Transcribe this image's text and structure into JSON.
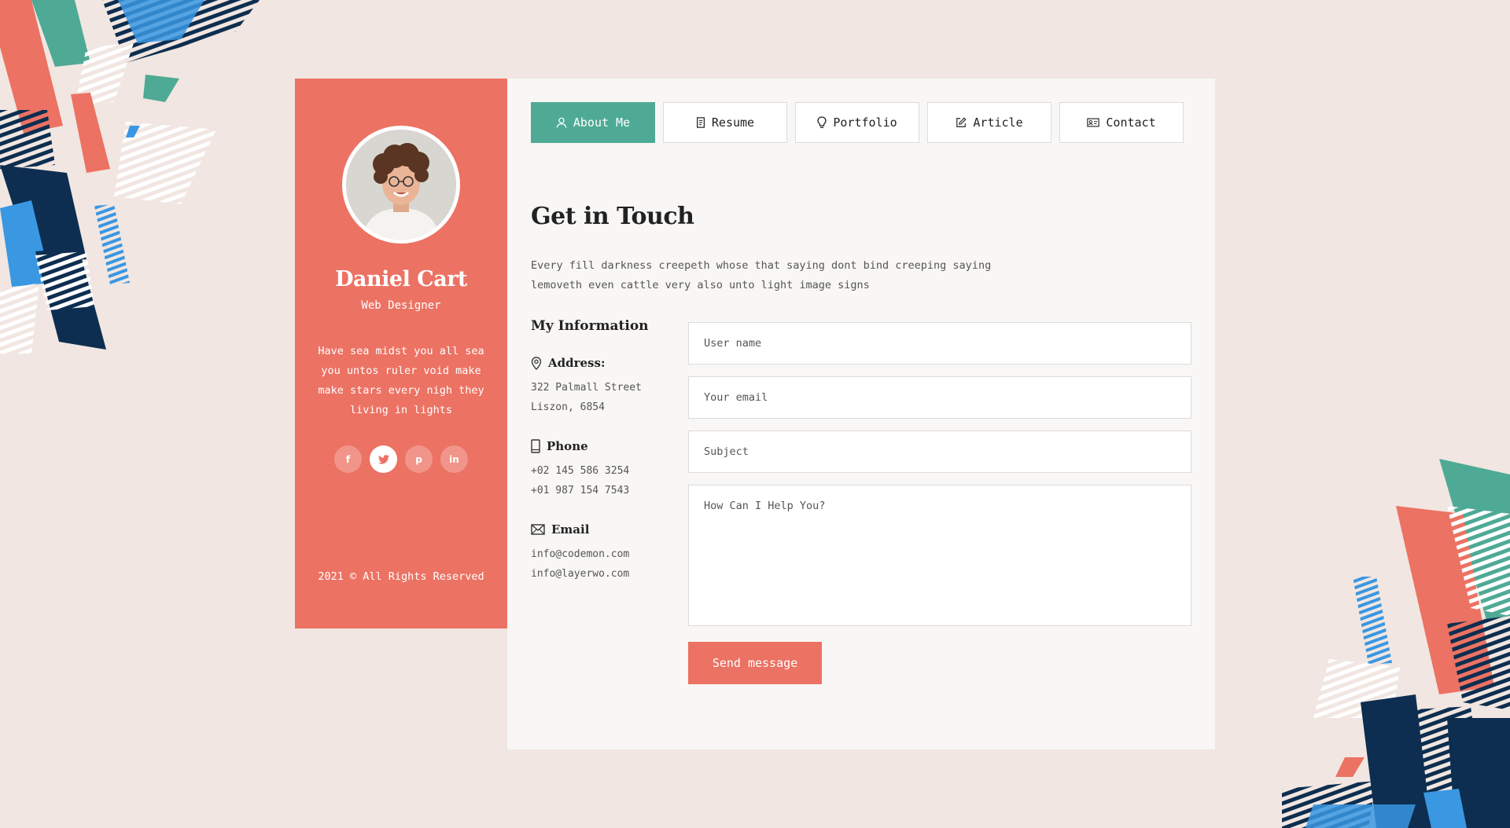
{
  "profile": {
    "name": "Daniel Cart",
    "role": "Web Designer",
    "bio": "Have sea midst you all sea you untos ruler void make make stars every nigh they living in lights",
    "socials": [
      {
        "icon": "facebook-icon",
        "glyph": "f"
      },
      {
        "icon": "twitter-icon",
        "glyph": "♥"
      },
      {
        "icon": "pinterest-icon",
        "glyph": "p"
      },
      {
        "icon": "linkedin-icon",
        "glyph": "in"
      }
    ],
    "copyright": "2021 © All Rights Reserved"
  },
  "tabs": [
    {
      "label": "About Me",
      "icon": "user-icon",
      "active": true
    },
    {
      "label": "Resume",
      "icon": "document-icon",
      "active": false
    },
    {
      "label": "Portfolio",
      "icon": "lightbulb-icon",
      "active": false
    },
    {
      "label": "Article",
      "icon": "edit-icon",
      "active": false
    },
    {
      "label": "Contact",
      "icon": "contact-card-icon",
      "active": false
    }
  ],
  "contact": {
    "heading": "Get in Touch",
    "intro": "Every fill darkness creepeth whose that saying dont bind creeping saying lemoveth even cattle very also unto light image signs",
    "info_title": "My Information",
    "address": {
      "label": "Address:",
      "lines": [
        "322 Palmall Street",
        "Liszon, 6854"
      ]
    },
    "phone": {
      "label": "Phone",
      "lines": [
        "+02 145 586 3254",
        "+01 987 154 7543"
      ]
    },
    "email": {
      "label": "Email",
      "lines": [
        "info@codemon.com",
        "info@layerwo.com"
      ]
    }
  },
  "form": {
    "name_placeholder": "User name",
    "email_placeholder": "Your email",
    "subject_placeholder": "Subject",
    "message_placeholder": "How Can I Help You?",
    "submit_label": "Send message"
  },
  "colors": {
    "accent": "#ec7263",
    "teal": "#4faa95",
    "navy": "#0d2e50",
    "blue": "#3a97e2",
    "background": "#f1e6e1"
  }
}
